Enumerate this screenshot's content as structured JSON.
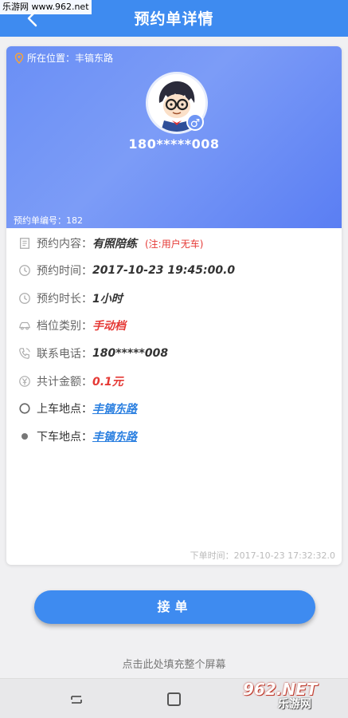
{
  "watermark_top": "乐游网 www.962.net",
  "header": {
    "title": "预约单详情"
  },
  "hero": {
    "location": "所在位置：丰镐东路",
    "phone": "180*****008",
    "gender_symbol": "♂",
    "order_number": "预约单编号：182"
  },
  "details": [
    {
      "label": "预约内容：",
      "value": "有照陪练",
      "note": "(注:用户无车)",
      "icon": "receipt-icon"
    },
    {
      "label": "预约时间：",
      "value": "2017-10-23 19:45:00.0",
      "icon": "clock-icon"
    },
    {
      "label": "预约时长：",
      "value": "1小时",
      "icon": "clock-icon"
    },
    {
      "label": "档位类别：",
      "value": "手动档",
      "icon": "car-icon"
    },
    {
      "label": "联系电话：",
      "value": "180*****008",
      "icon": "phone-icon"
    },
    {
      "label": "共计金额：",
      "value": "0.1元",
      "icon": "yen-icon"
    },
    {
      "label": "上车地点：",
      "value": "丰镐东路",
      "icon": "hollow-circle-icon"
    },
    {
      "label": "下车地点：",
      "value": "丰镐东路",
      "icon": "filled-dot-icon"
    }
  ],
  "order_time": "下单时间：2017-10-23 17:32:32.0",
  "accept_button": "接单",
  "fill_screen_hint": "点击此处填充整个屏幕",
  "watermark_logo": {
    "brand": "962.NET",
    "sub": "乐游网"
  },
  "colors": {
    "primary": "#3e8bf0",
    "accent_red": "#e53935",
    "link_blue": "#2a7fe0"
  }
}
